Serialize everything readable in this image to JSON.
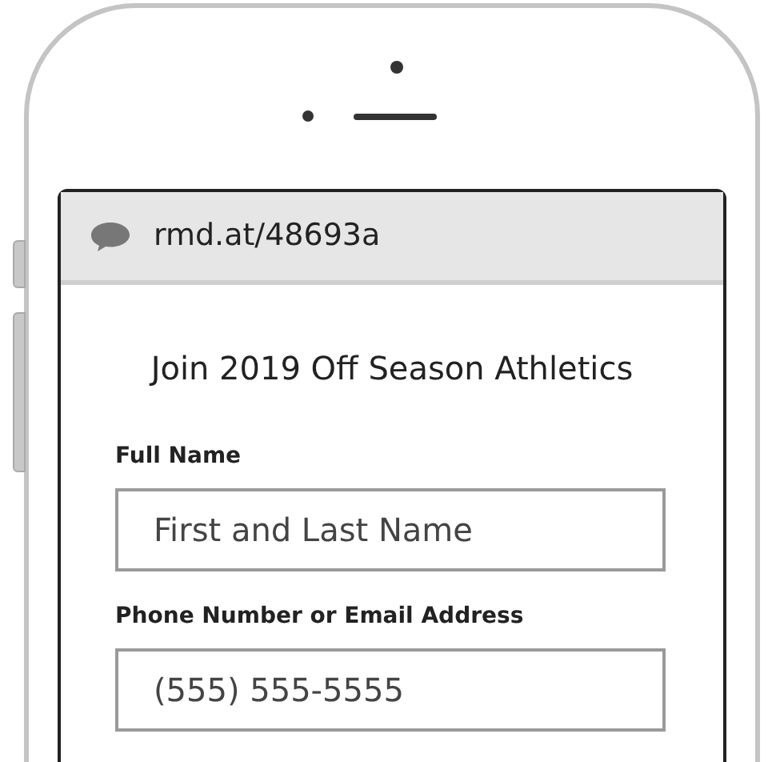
{
  "address_bar": {
    "url": "rmd.at/48693a"
  },
  "form": {
    "title": "Join 2019 Off Season Athletics",
    "fields": [
      {
        "label": "Full Name",
        "placeholder": "First and Last Name"
      },
      {
        "label": "Phone Number or Email Address",
        "placeholder": "(555) 555-5555"
      }
    ]
  }
}
